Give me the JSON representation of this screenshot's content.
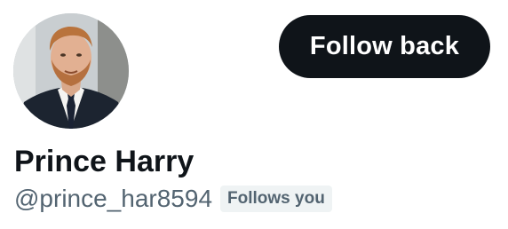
{
  "profile": {
    "display_name": "Prince Harry",
    "handle": "@prince_har8594",
    "follows_you_label": "Follows you",
    "avatar_alt": "Prince Harry"
  },
  "actions": {
    "follow_back_label": "Follow back"
  },
  "colors": {
    "button_bg": "#0f1419",
    "button_text": "#ffffff",
    "name_text": "#0f1419",
    "secondary_text": "#536471",
    "badge_bg": "#eff3f4"
  }
}
